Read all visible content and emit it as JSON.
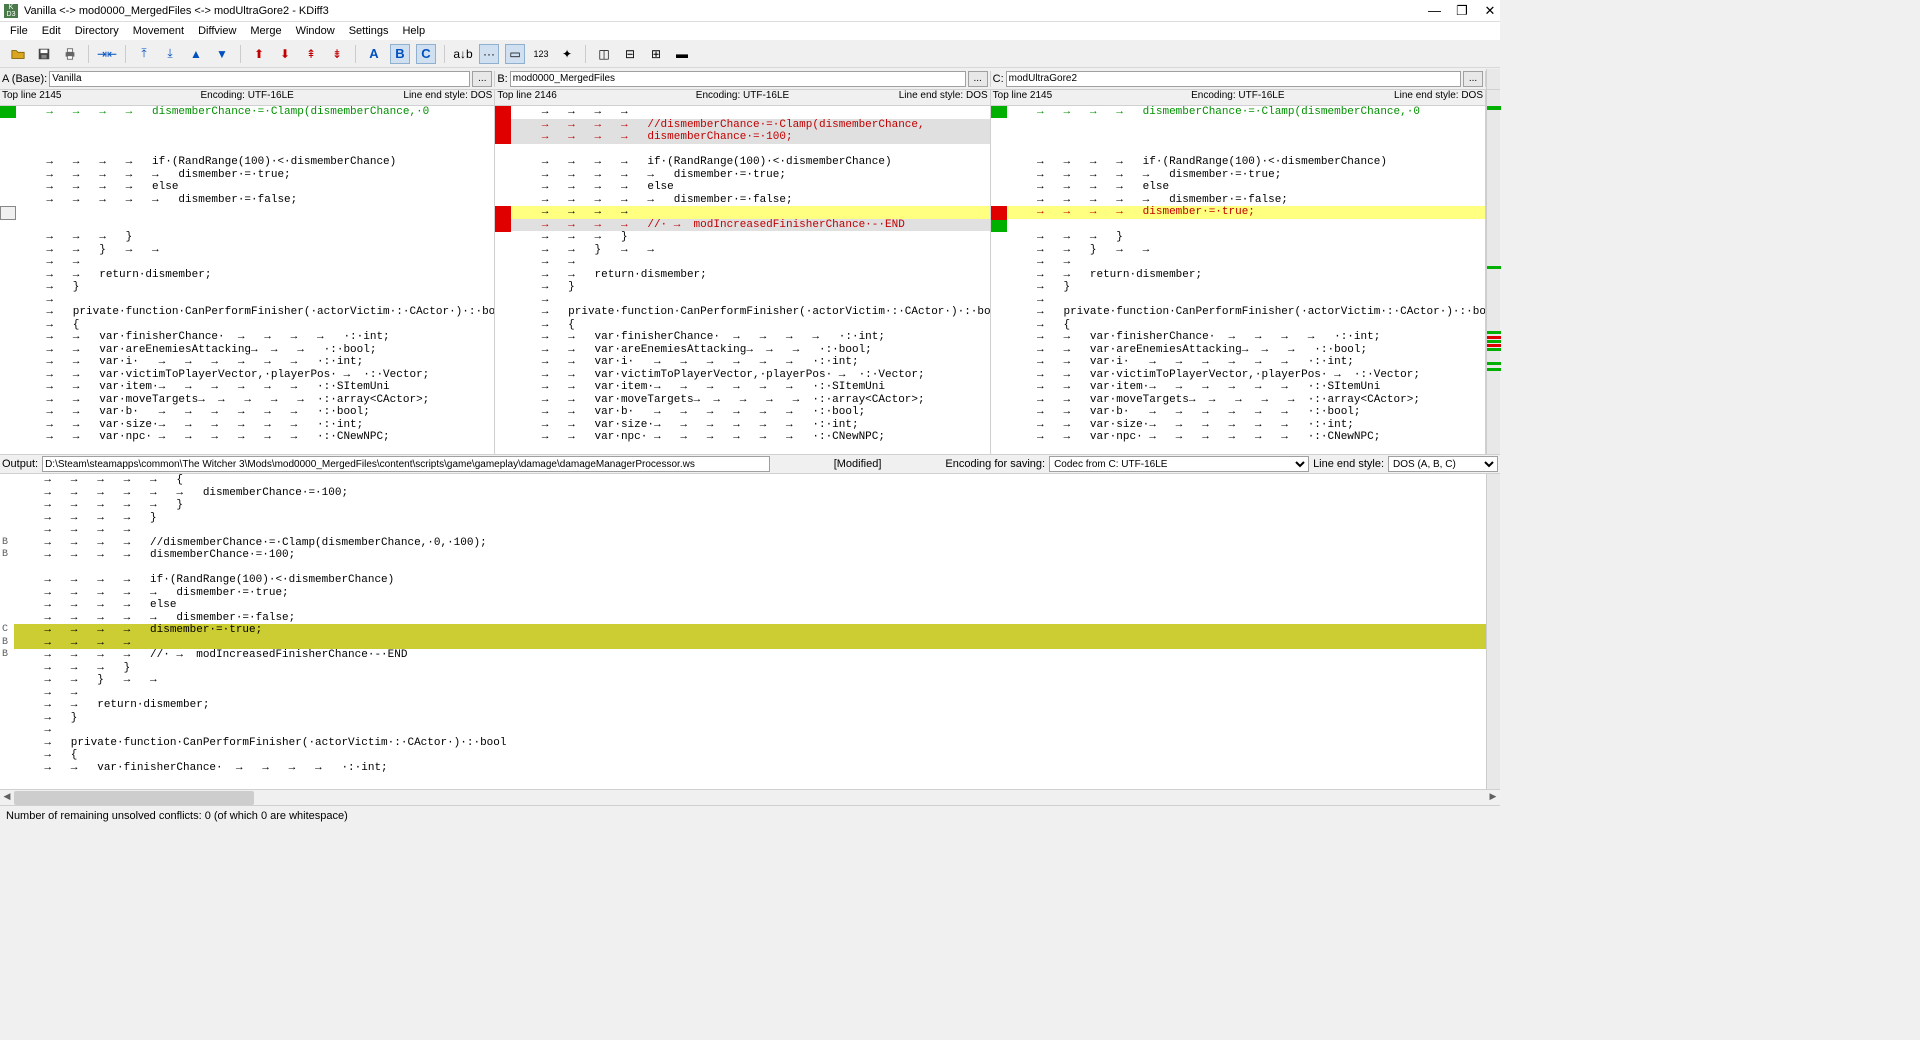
{
  "title": "Vanilla <-> mod0000_MergedFiles <-> modUltraGore2 - KDiff3",
  "menu": [
    "File",
    "Edit",
    "Directory",
    "Movement",
    "Diffview",
    "Merge",
    "Window",
    "Settings",
    "Help"
  ],
  "panes": {
    "a": {
      "label": "A (Base):",
      "path": "Vanilla",
      "topline": "Top line 2145",
      "encoding": "Encoding: UTF-16LE",
      "lineend": "Line end style: DOS"
    },
    "b": {
      "label": "B:",
      "path": "mod0000_MergedFiles",
      "topline": "Top line 2146",
      "encoding": "Encoding: UTF-16LE",
      "lineend": "Line end style: DOS"
    },
    "c": {
      "label": "C:",
      "path": "modUltraGore2",
      "topline": "Top line 2145",
      "encoding": "Encoding: UTF-16LE",
      "lineend": "Line end style: DOS"
    }
  },
  "codeA": [
    {
      "t": "    →   →   →   →   dismemberChance·=·Clamp(dismemberChance,·0",
      "cls": "green"
    },
    {
      "t": ""
    },
    {
      "t": ""
    },
    {
      "t": ""
    },
    {
      "t": "    →   →   →   →   if·(RandRange(100)·<·dismemberChance)"
    },
    {
      "t": "    →   →   →   →   →   dismember·=·true;"
    },
    {
      "t": "    →   →   →   →   else"
    },
    {
      "t": "    →   →   →   →   →   dismember·=·false;"
    },
    {
      "t": ""
    },
    {
      "t": ""
    },
    {
      "t": "    →   →   →   }"
    },
    {
      "t": "    →   →   }   →   →"
    },
    {
      "t": "    →   →"
    },
    {
      "t": "    →   →   return·dismember;"
    },
    {
      "t": "    →   }"
    },
    {
      "t": "    →"
    },
    {
      "t": "    →   private·function·CanPerformFinisher(·actorVictim·:·CActor·)·:·bool"
    },
    {
      "t": "    →   {"
    },
    {
      "t": "    →   →   var·finisherChance·  →   →   →   →   ·:·int;"
    },
    {
      "t": "    →   →   var·areEnemiesAttacking→  →   →   ·:·bool;"
    },
    {
      "t": "    →   →   var·i·   →   →   →   →   →   →   ·:·int;"
    },
    {
      "t": "    →   →   var·victimToPlayerVector,·playerPos· →  ·:·Vector;"
    },
    {
      "t": "    →   →   var·item·→   →   →   →   →   →   ·:·SItemUni"
    },
    {
      "t": "    →   →   var·moveTargets→  →   →   →   →  ·:·array<CActor>;"
    },
    {
      "t": "    →   →   var·b·   →   →   →   →   →   →   ·:·bool;"
    },
    {
      "t": "    →   →   var·size·→   →   →   →   →   →   ·:·int;"
    },
    {
      "t": "    →   →   var·npc· →   →   →   →   →   →   ·:·CNewNPC;"
    }
  ],
  "codeB": [
    {
      "t": "    →   →   →   →"
    },
    {
      "t": "    →   →   →   →   //dismemberChance·=·Clamp(dismemberChance,",
      "cls": "red bg-grey"
    },
    {
      "t": "    →   →   →   →   dismemberChance·=·100;",
      "cls": "red bg-grey"
    },
    {
      "t": ""
    },
    {
      "t": "    →   →   →   →   if·(RandRange(100)·<·dismemberChance)"
    },
    {
      "t": "    →   →   →   →   →   dismember·=·true;"
    },
    {
      "t": "    →   →   →   →   else"
    },
    {
      "t": "    →   →   →   →   →   dismember·=·false;"
    },
    {
      "t": "    →   →   →   →",
      "cls": "bg-yellow"
    },
    {
      "t": "    →   →   →   →   //· →  modIncreasedFinisherChance·-·END",
      "cls": "red bg-grey"
    },
    {
      "t": "    →   →   →   }"
    },
    {
      "t": "    →   →   }   →   →"
    },
    {
      "t": "    →   →"
    },
    {
      "t": "    →   →   return·dismember;"
    },
    {
      "t": "    →   }"
    },
    {
      "t": "    →"
    },
    {
      "t": "    →   private·function·CanPerformFinisher(·actorVictim·:·CActor·)·:·bool"
    },
    {
      "t": "    →   {"
    },
    {
      "t": "    →   →   var·finisherChance·  →   →   →   →   ·:·int;"
    },
    {
      "t": "    →   →   var·areEnemiesAttacking→  →   →   ·:·bool;"
    },
    {
      "t": "    →   →   var·i·   →   →   →   →   →   →   ·:·int;"
    },
    {
      "t": "    →   →   var·victimToPlayerVector,·playerPos· →  ·:·Vector;"
    },
    {
      "t": "    →   →   var·item·→   →   →   →   →   →   ·:·SItemUni"
    },
    {
      "t": "    →   →   var·moveTargets→  →   →   →   →  ·:·array<CActor>;"
    },
    {
      "t": "    →   →   var·b·   →   →   →   →   →   →   ·:·bool;"
    },
    {
      "t": "    →   →   var·size·→   →   →   →   →   →   ·:·int;"
    },
    {
      "t": "    →   →   var·npc· →   →   →   →   →   →   ·:·CNewNPC;"
    }
  ],
  "codeC": [
    {
      "t": "    →   →   →   →   dismemberChance·=·Clamp(dismemberChance,·0",
      "cls": "green"
    },
    {
      "t": ""
    },
    {
      "t": ""
    },
    {
      "t": ""
    },
    {
      "t": "    →   →   →   →   if·(RandRange(100)·<·dismemberChance)"
    },
    {
      "t": "    →   →   →   →   →   dismember·=·true;"
    },
    {
      "t": "    →   →   →   →   else"
    },
    {
      "t": "    →   →   →   →   →   dismember·=·false;"
    },
    {
      "t": "    →   →   →   →   dismember·=·true;",
      "cls": "red bg-yellow"
    },
    {
      "t": ""
    },
    {
      "t": "    →   →   →   }"
    },
    {
      "t": "    →   →   }   →   →"
    },
    {
      "t": "    →   →"
    },
    {
      "t": "    →   →   return·dismember;"
    },
    {
      "t": "    →   }"
    },
    {
      "t": "    →"
    },
    {
      "t": "    →   private·function·CanPerformFinisher(·actorVictim·:·CActor·)·:·bool"
    },
    {
      "t": "    →   {"
    },
    {
      "t": "    →   →   var·finisherChance·  →   →   →   →   ·:·int;"
    },
    {
      "t": "    →   →   var·areEnemiesAttacking→  →   →   ·:·bool;"
    },
    {
      "t": "    →   →   var·i·   →   →   →   →   →   →   ·:·int;"
    },
    {
      "t": "    →   →   var·victimToPlayerVector,·playerPos· →  ·:·Vector;"
    },
    {
      "t": "    →   →   var·item·→   →   →   →   →   →   ·:·SItemUni"
    },
    {
      "t": "    →   →   var·moveTargets→  →   →   →   →  ·:·array<CActor>;"
    },
    {
      "t": "    →   →   var·b·   →   →   →   →   →   →   ·:·bool;"
    },
    {
      "t": "    →   →   var·size·→   →   →   →   →   →   ·:·int;"
    },
    {
      "t": "    →   →   var·npc· →   →   →   →   →   →   ·:·CNewNPC;"
    }
  ],
  "output": {
    "label": "Output:",
    "path": "D:\\Steam\\steamapps\\common\\The Witcher 3\\Mods\\mod0000_MergedFiles\\content\\scripts\\game\\gameplay\\damage\\damageManagerProcessor.ws",
    "modified": "[Modified]",
    "encsave_label": "Encoding for saving:",
    "encsave_value": "Codec from C: UTF-16LE",
    "lineend_label": "Line end style:",
    "lineend_value": "DOS (A, B, C)"
  },
  "outGutter": [
    "",
    "",
    "",
    "",
    "",
    "B",
    "B",
    "",
    "",
    "",
    "",
    "",
    "C",
    "B",
    "B",
    "",
    "",
    "",
    "",
    "",
    "",
    "",
    "",
    "",
    ""
  ],
  "outCode": [
    {
      "t": "    →   →   →   →   →   {"
    },
    {
      "t": "    →   →   →   →   →   →   dismemberChance·=·100;"
    },
    {
      "t": "    →   →   →   →   →   }"
    },
    {
      "t": "    →   →   →   →   }"
    },
    {
      "t": "    →   →   →   →"
    },
    {
      "t": "    →   →   →   →   //dismemberChance·=·Clamp(dismemberChance,·0,·100);"
    },
    {
      "t": "    →   →   →   →   dismemberChance·=·100;"
    },
    {
      "t": ""
    },
    {
      "t": "    →   →   →   →   if·(RandRange(100)·<·dismemberChance)"
    },
    {
      "t": "    →   →   →   →   →   dismember·=·true;"
    },
    {
      "t": "    →   →   →   →   else"
    },
    {
      "t": "    →   →   →   →   →   dismember·=·false;"
    },
    {
      "t": "    →   →   →   →   dismember·=·true;",
      "cls": "bg-olive"
    },
    {
      "t": "    →   →   →   →",
      "cls": "bg-olive"
    },
    {
      "t": "    →   →   →   →   //· →  modIncreasedFinisherChance·-·END"
    },
    {
      "t": "    →   →   →   }"
    },
    {
      "t": "    →   →   }   →   →"
    },
    {
      "t": "    →   →"
    },
    {
      "t": "    →   →   return·dismember;"
    },
    {
      "t": "    →   }"
    },
    {
      "t": "    →"
    },
    {
      "t": "    →   private·function·CanPerformFinisher(·actorVictim·:·CActor·)·:·bool"
    },
    {
      "t": "    →   {"
    },
    {
      "t": "    →   →   var·finisherChance·  →   →   →   →   ·:·int;"
    }
  ],
  "status": "Number of remaining unsolved conflicts: 0 (of which 0 are whitespace)"
}
